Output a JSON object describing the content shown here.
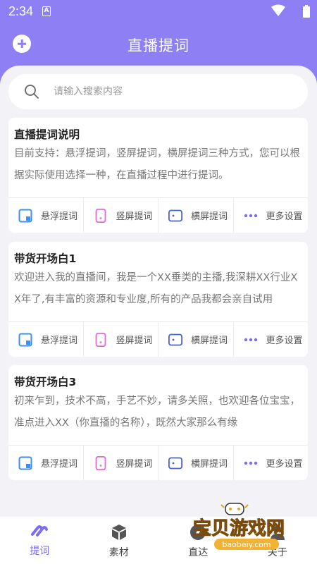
{
  "status_bar": {
    "time": "2:34"
  },
  "app_bar": {
    "title": "直播提词"
  },
  "search": {
    "placeholder": "请输入搜索内容",
    "value": ""
  },
  "cards": [
    {
      "title": "直播提词说明",
      "body": "目前支持：悬浮提词，竖屏提词，横屏提词三种方式，您可以根据实际使用选择一种，在直播过程中进行提词。"
    },
    {
      "title": "带货开场白1",
      "body": "欢迎进入我的直播间，我是一个XX垂类的主播,我深耕XX行业XX年了,有丰富的资源和专业度,所有的产品我都会亲自试用"
    },
    {
      "title": "带货开场白3",
      "body": "初来乍到，技术不高，手艺不妙，请多关照，也欢迎各位宝宝，准点进入XX（你直播的名称），既然大家那么有缘"
    }
  ],
  "actions": {
    "float": "悬浮提词",
    "portrait": "竖屏提词",
    "landscape": "横屏提词",
    "more": "更多设置"
  },
  "bottom_nav": [
    {
      "label": "提词",
      "icon": "prompt-icon",
      "active": true
    },
    {
      "label": "素材",
      "icon": "cube-icon",
      "active": false
    },
    {
      "label": "直达",
      "icon": "compass-icon",
      "active": false
    },
    {
      "label": "关于",
      "icon": "person-icon",
      "active": false
    }
  ],
  "watermark": {
    "text": "宝贝游戏网",
    "url": "baobeiy.com"
  },
  "colors": {
    "primary": "#8f7ff5",
    "float_icon": "#3d8ef0",
    "portrait_icon": "#e46ad6",
    "landscape_icon": "#4a62d8",
    "more_icon": "#7b6cf0"
  }
}
